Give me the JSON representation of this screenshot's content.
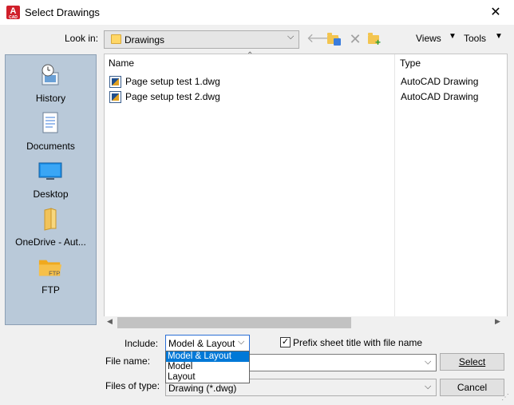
{
  "window": {
    "title": "Select Drawings",
    "app_icon_letter": "A",
    "app_icon_sub": "CAD",
    "close_glyph": "✕"
  },
  "toolbar": {
    "look_in_label": "Look in:",
    "look_in_value": "Drawings",
    "views_label": "Views",
    "tools_label": "Tools"
  },
  "places": [
    {
      "label": "History",
      "icon": "history-icon"
    },
    {
      "label": "Documents",
      "icon": "documents-icon"
    },
    {
      "label": "Desktop",
      "icon": "desktop-icon"
    },
    {
      "label": "OneDrive - Aut...",
      "icon": "onedrive-folder-icon"
    },
    {
      "label": "FTP",
      "icon": "ftp-folder-icon",
      "icon_text": "FTP"
    }
  ],
  "file_list": {
    "columns": [
      "Name",
      "Type"
    ],
    "rows": [
      {
        "name": "Page setup test 1.dwg",
        "type": "AutoCAD Drawing"
      },
      {
        "name": "Page setup test 2.dwg",
        "type": "AutoCAD Drawing"
      }
    ]
  },
  "options": {
    "include_label": "Include:",
    "include_value": "Model & Layout",
    "include_options": [
      "Model & Layout",
      "Model",
      "Layout"
    ],
    "prefix_checked": true,
    "prefix_label": "Prefix sheet title with file name"
  },
  "fields": {
    "file_name_label": "File name:",
    "file_name_value": "",
    "files_of_type_label": "Files of type:",
    "files_of_type_value": "Drawing (*.dwg)"
  },
  "buttons": {
    "select_label": "Select",
    "cancel_label": "Cancel"
  },
  "colors": {
    "selection_blue": "#0078d7",
    "places_bg": "#b9c9d9"
  }
}
